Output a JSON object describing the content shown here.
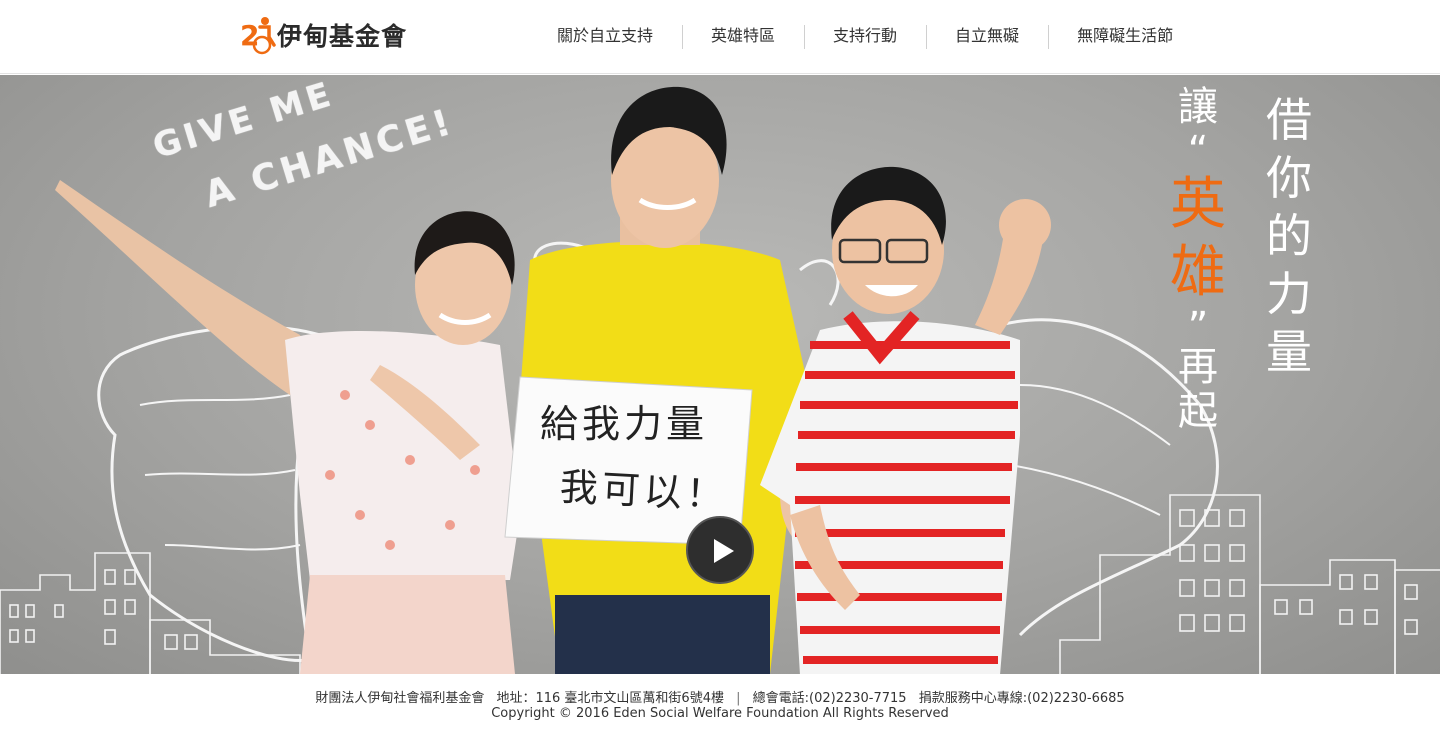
{
  "brand": {
    "name": "伊甸基金會",
    "accent_color": "#ef6b12",
    "logo_icon": "eden-wheelchair-logo-icon",
    "logo_mark_text": "2"
  },
  "nav": {
    "items": [
      {
        "label": "關於自立支持"
      },
      {
        "label": "英雄特區"
      },
      {
        "label": "支持行動"
      },
      {
        "label": "自立無礙"
      },
      {
        "label": "無障礙生活節"
      }
    ]
  },
  "hero": {
    "chalk_text_line1": "GIVE ME",
    "chalk_text_line2": "A CHANCE!",
    "sign_line1": "給我力量",
    "sign_line2": "我可以！",
    "slogan_right": [
      "借",
      "你",
      "的",
      "力",
      "量"
    ],
    "slogan_left_prefix": "讓",
    "slogan_left_open_quote": "“",
    "slogan_left_highlight": [
      "英",
      "雄"
    ],
    "slogan_left_close_quote": "”",
    "slogan_left_suffix": [
      "再",
      "起"
    ],
    "play_icon": "play-icon"
  },
  "footer": {
    "org_name": "財團法人伊甸社會福利基金會",
    "address": "地址：116 臺北市文山區萬和街6號4樓",
    "separator": "|",
    "phone": "總會電話:(02)2230-7715",
    "donation_phone": "捐款服務中心專線:(02)2230-6685",
    "copyright": "Copyright © 2016 Eden Social Welfare Foundation All Rights Reserved"
  }
}
